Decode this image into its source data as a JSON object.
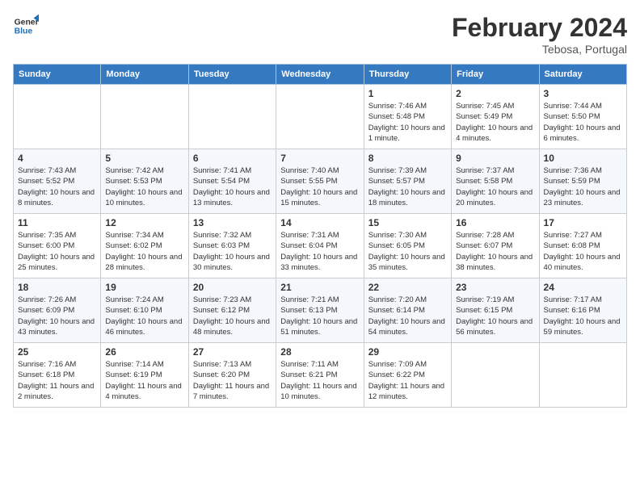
{
  "header": {
    "logo_general": "General",
    "logo_blue": "Blue",
    "month_title": "February 2024",
    "subtitle": "Tebosa, Portugal"
  },
  "weekdays": [
    "Sunday",
    "Monday",
    "Tuesday",
    "Wednesday",
    "Thursday",
    "Friday",
    "Saturday"
  ],
  "weeks": [
    [
      {
        "day": "",
        "info": ""
      },
      {
        "day": "",
        "info": ""
      },
      {
        "day": "",
        "info": ""
      },
      {
        "day": "",
        "info": ""
      },
      {
        "day": "1",
        "info": "Sunrise: 7:46 AM\nSunset: 5:48 PM\nDaylight: 10 hours and 1 minute."
      },
      {
        "day": "2",
        "info": "Sunrise: 7:45 AM\nSunset: 5:49 PM\nDaylight: 10 hours and 4 minutes."
      },
      {
        "day": "3",
        "info": "Sunrise: 7:44 AM\nSunset: 5:50 PM\nDaylight: 10 hours and 6 minutes."
      }
    ],
    [
      {
        "day": "4",
        "info": "Sunrise: 7:43 AM\nSunset: 5:52 PM\nDaylight: 10 hours and 8 minutes."
      },
      {
        "day": "5",
        "info": "Sunrise: 7:42 AM\nSunset: 5:53 PM\nDaylight: 10 hours and 10 minutes."
      },
      {
        "day": "6",
        "info": "Sunrise: 7:41 AM\nSunset: 5:54 PM\nDaylight: 10 hours and 13 minutes."
      },
      {
        "day": "7",
        "info": "Sunrise: 7:40 AM\nSunset: 5:55 PM\nDaylight: 10 hours and 15 minutes."
      },
      {
        "day": "8",
        "info": "Sunrise: 7:39 AM\nSunset: 5:57 PM\nDaylight: 10 hours and 18 minutes."
      },
      {
        "day": "9",
        "info": "Sunrise: 7:37 AM\nSunset: 5:58 PM\nDaylight: 10 hours and 20 minutes."
      },
      {
        "day": "10",
        "info": "Sunrise: 7:36 AM\nSunset: 5:59 PM\nDaylight: 10 hours and 23 minutes."
      }
    ],
    [
      {
        "day": "11",
        "info": "Sunrise: 7:35 AM\nSunset: 6:00 PM\nDaylight: 10 hours and 25 minutes."
      },
      {
        "day": "12",
        "info": "Sunrise: 7:34 AM\nSunset: 6:02 PM\nDaylight: 10 hours and 28 minutes."
      },
      {
        "day": "13",
        "info": "Sunrise: 7:32 AM\nSunset: 6:03 PM\nDaylight: 10 hours and 30 minutes."
      },
      {
        "day": "14",
        "info": "Sunrise: 7:31 AM\nSunset: 6:04 PM\nDaylight: 10 hours and 33 minutes."
      },
      {
        "day": "15",
        "info": "Sunrise: 7:30 AM\nSunset: 6:05 PM\nDaylight: 10 hours and 35 minutes."
      },
      {
        "day": "16",
        "info": "Sunrise: 7:28 AM\nSunset: 6:07 PM\nDaylight: 10 hours and 38 minutes."
      },
      {
        "day": "17",
        "info": "Sunrise: 7:27 AM\nSunset: 6:08 PM\nDaylight: 10 hours and 40 minutes."
      }
    ],
    [
      {
        "day": "18",
        "info": "Sunrise: 7:26 AM\nSunset: 6:09 PM\nDaylight: 10 hours and 43 minutes."
      },
      {
        "day": "19",
        "info": "Sunrise: 7:24 AM\nSunset: 6:10 PM\nDaylight: 10 hours and 46 minutes."
      },
      {
        "day": "20",
        "info": "Sunrise: 7:23 AM\nSunset: 6:12 PM\nDaylight: 10 hours and 48 minutes."
      },
      {
        "day": "21",
        "info": "Sunrise: 7:21 AM\nSunset: 6:13 PM\nDaylight: 10 hours and 51 minutes."
      },
      {
        "day": "22",
        "info": "Sunrise: 7:20 AM\nSunset: 6:14 PM\nDaylight: 10 hours and 54 minutes."
      },
      {
        "day": "23",
        "info": "Sunrise: 7:19 AM\nSunset: 6:15 PM\nDaylight: 10 hours and 56 minutes."
      },
      {
        "day": "24",
        "info": "Sunrise: 7:17 AM\nSunset: 6:16 PM\nDaylight: 10 hours and 59 minutes."
      }
    ],
    [
      {
        "day": "25",
        "info": "Sunrise: 7:16 AM\nSunset: 6:18 PM\nDaylight: 11 hours and 2 minutes."
      },
      {
        "day": "26",
        "info": "Sunrise: 7:14 AM\nSunset: 6:19 PM\nDaylight: 11 hours and 4 minutes."
      },
      {
        "day": "27",
        "info": "Sunrise: 7:13 AM\nSunset: 6:20 PM\nDaylight: 11 hours and 7 minutes."
      },
      {
        "day": "28",
        "info": "Sunrise: 7:11 AM\nSunset: 6:21 PM\nDaylight: 11 hours and 10 minutes."
      },
      {
        "day": "29",
        "info": "Sunrise: 7:09 AM\nSunset: 6:22 PM\nDaylight: 11 hours and 12 minutes."
      },
      {
        "day": "",
        "info": ""
      },
      {
        "day": "",
        "info": ""
      }
    ]
  ]
}
